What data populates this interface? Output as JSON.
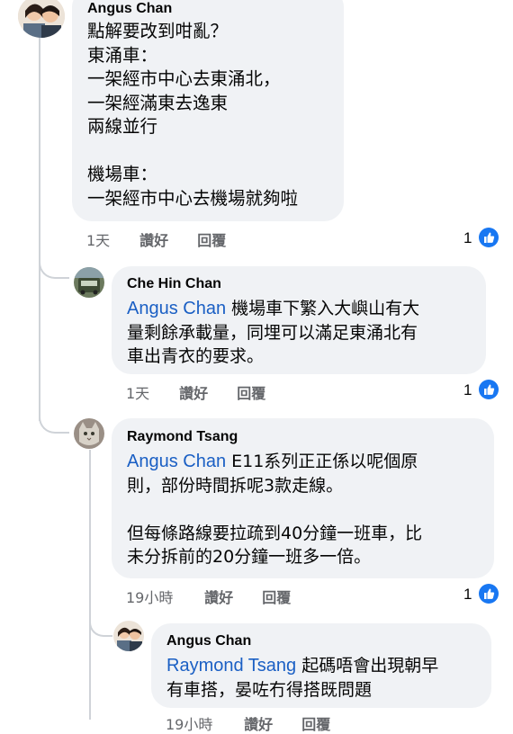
{
  "comments": [
    {
      "author": "Angus Chan",
      "mention": "",
      "text": "點解要改到咁亂？\n東涌車：\n一架經市中心去東涌北，\n一架經滿東去逸東\n兩線並行\n\n機場車：\n一架經市中心去機場就夠啦",
      "time": "1天",
      "like_label": "讚好",
      "reply_label": "回覆",
      "reactions": "1"
    },
    {
      "author": "Che Hin Chan",
      "mention": "Angus Chan",
      "text": " 機場車下繁入大嶼山有大\n量剩餘承載量，同埋可以滿足東涌北有\n車出青衣的要求。",
      "time": "1天",
      "like_label": "讚好",
      "reply_label": "回覆",
      "reactions": "1"
    },
    {
      "author": "Raymond Tsang",
      "mention": "Angus Chan",
      "text": " E11系列正正係以呢個原\n則，部份時間拆呢3款走線。\n\n但每條路線要拉疏到40分鐘一班車，比\n未分拆前的20分鐘一班多一倍。",
      "time": "19小時",
      "like_label": "讚好",
      "reply_label": "回覆",
      "reactions": "1"
    },
    {
      "author": "Angus Chan",
      "mention": "Raymond Tsang",
      "text": " 起碼唔會出現朝早\n有車搭，晏咗冇得搭既問題",
      "time": "19小時",
      "like_label": "讚好",
      "reply_label": "回覆",
      "reactions": ""
    }
  ],
  "colors": {
    "bubble": "#f0f2f5",
    "mention": "#1a5fc4",
    "meta": "#65676b",
    "like": "#1877f2",
    "thread_line": "#cfd3d8"
  },
  "icons": [
    "avatar-couple-photo",
    "avatar-bus-photo",
    "avatar-cat-photo",
    "thumbs-up-icon"
  ]
}
